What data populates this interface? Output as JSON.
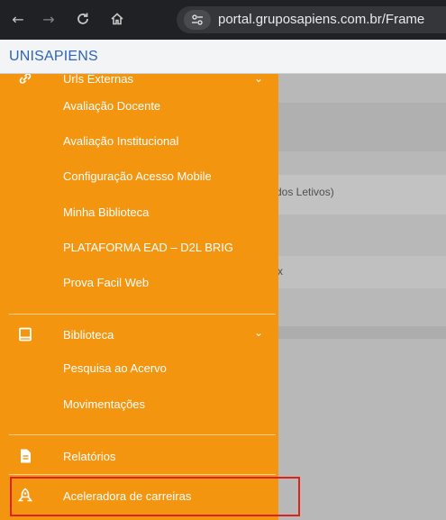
{
  "browser": {
    "url": "portal.gruposapiens.com.br/Frame",
    "back_icon": "arrow-left-icon",
    "forward_icon": "arrow-right-icon",
    "reload_icon": "reload-icon",
    "home_icon": "home-icon",
    "site_info_icon": "tune-icon"
  },
  "app": {
    "title": "UNISAPIENS"
  },
  "background": {
    "text_1": "dos Letivos)",
    "text_2": "x"
  },
  "sidebar": {
    "partial_top_label": "Urls Externas",
    "submenu_1": [
      "Avaliação Docente",
      "Avaliação Institucional",
      "Configuração Acesso Mobile",
      "Minha Biblioteca",
      "PLATAFORMA EAD – D2L BRIG",
      "Prova Facil Web"
    ],
    "biblioteca_label": "Biblioteca",
    "submenu_2": [
      "Pesquisa ao Acervo",
      "Movimentações"
    ],
    "relatorios_label": "Relatórios",
    "aceleradora_label": "Aceleradora de carreiras"
  },
  "colors": {
    "sidebar": "#f3950f",
    "highlight": "#e0201b",
    "brand_text": "#2f64b8"
  }
}
